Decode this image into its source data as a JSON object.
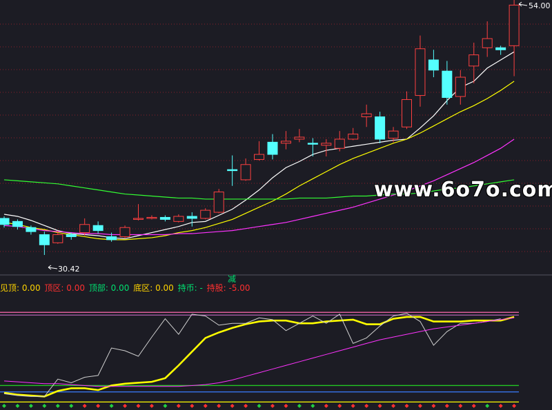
{
  "chart_data": [
    {
      "type": "candlestick",
      "panel": "price",
      "ylim": [
        28.5,
        55.5
      ],
      "grid": true,
      "high_label": "54.00",
      "low_label": "30.42",
      "candles": [
        {
          "o": 34.0,
          "c": 33.4,
          "h": 34.2,
          "l": 33.1
        },
        {
          "o": 33.7,
          "c": 33.2,
          "h": 33.9,
          "l": 32.9
        },
        {
          "o": 33.1,
          "c": 32.7,
          "h": 33.3,
          "l": 32.4
        },
        {
          "o": 32.4,
          "c": 31.4,
          "h": 32.7,
          "l": 30.4
        },
        {
          "o": 31.6,
          "c": 32.4,
          "h": 32.8,
          "l": 31.5
        },
        {
          "o": 32.4,
          "c": 32.2,
          "h": 32.6,
          "l": 31.9
        },
        {
          "o": 32.6,
          "c": 33.4,
          "h": 34.0,
          "l": 32.3
        },
        {
          "o": 33.3,
          "c": 32.8,
          "h": 33.7,
          "l": 32.5
        },
        {
          "o": 32.2,
          "c": 31.9,
          "h": 32.6,
          "l": 31.7
        },
        {
          "o": 32.2,
          "c": 33.1,
          "h": 33.3,
          "l": 32.0
        },
        {
          "o": 33.9,
          "c": 34.0,
          "h": 35.4,
          "l": 33.8
        },
        {
          "o": 34.0,
          "c": 34.1,
          "h": 34.3,
          "l": 33.9
        },
        {
          "o": 34.1,
          "c": 33.9,
          "h": 34.3,
          "l": 33.7
        },
        {
          "o": 33.7,
          "c": 34.2,
          "h": 34.4,
          "l": 33.6
        },
        {
          "o": 34.2,
          "c": 34.0,
          "h": 34.6,
          "l": 33.2
        },
        {
          "o": 34.0,
          "c": 34.8,
          "h": 35.0,
          "l": 33.9
        },
        {
          "o": 34.6,
          "c": 36.6,
          "h": 36.9,
          "l": 34.5
        },
        {
          "o": 38.8,
          "c": 38.7,
          "h": 40.2,
          "l": 37.2
        },
        {
          "o": 37.8,
          "c": 39.3,
          "h": 39.9,
          "l": 37.7
        },
        {
          "o": 39.8,
          "c": 40.3,
          "h": 41.6,
          "l": 39.7
        },
        {
          "o": 41.5,
          "c": 40.3,
          "h": 42.3,
          "l": 39.8
        },
        {
          "o": 41.4,
          "c": 41.6,
          "h": 42.6,
          "l": 40.8
        },
        {
          "o": 41.8,
          "c": 42.0,
          "h": 42.8,
          "l": 41.5
        },
        {
          "o": 41.4,
          "c": 41.3,
          "h": 41.9,
          "l": 40.1
        },
        {
          "o": 41.2,
          "c": 41.4,
          "h": 41.8,
          "l": 40.1
        },
        {
          "o": 40.9,
          "c": 41.8,
          "h": 42.6,
          "l": 40.6
        },
        {
          "o": 41.8,
          "c": 42.3,
          "h": 42.9,
          "l": 41.7
        },
        {
          "o": 44.0,
          "c": 44.3,
          "h": 45.2,
          "l": 43.0
        },
        {
          "o": 44.0,
          "c": 41.8,
          "h": 44.5,
          "l": 41.4
        },
        {
          "o": 41.9,
          "c": 42.6,
          "h": 43.0,
          "l": 41.5
        },
        {
          "o": 43.0,
          "c": 45.7,
          "h": 46.5,
          "l": 42.8
        },
        {
          "o": 46.1,
          "c": 50.7,
          "h": 52.0,
          "l": 45.0
        },
        {
          "o": 49.6,
          "c": 48.6,
          "h": 50.6,
          "l": 47.9
        },
        {
          "o": 48.5,
          "c": 45.9,
          "h": 49.5,
          "l": 45.2
        },
        {
          "o": 46.0,
          "c": 47.9,
          "h": 48.6,
          "l": 45.2
        },
        {
          "o": 49.0,
          "c": 50.1,
          "h": 51.3,
          "l": 47.3
        },
        {
          "o": 50.8,
          "c": 51.7,
          "h": 53.4,
          "l": 49.9
        },
        {
          "o": 50.8,
          "c": 50.6,
          "h": 51.0,
          "l": 50.1
        },
        {
          "o": 51.0,
          "c": 55.0,
          "h": 56.0,
          "l": 48.0
        }
      ],
      "ma_series": [
        {
          "color": "#ffffff",
          "values": [
            34.4,
            34.2,
            33.8,
            33.3,
            32.8,
            32.5,
            32.4,
            32.3,
            32.1,
            32.0,
            32.3,
            32.6,
            32.9,
            33.2,
            33.6,
            33.7,
            34.3,
            34.9,
            35.8,
            36.8,
            38.0,
            39.0,
            39.6,
            40.3,
            40.7,
            40.9,
            41.1,
            41.3,
            41.5,
            41.7,
            41.8,
            42.9,
            44.1,
            45.6,
            46.9,
            47.5,
            48.8,
            49.6,
            50.4
          ]
        },
        {
          "color": "#ffff00",
          "values": [
            33.6,
            33.4,
            33.1,
            32.9,
            32.6,
            32.4,
            32.2,
            32.0,
            31.9,
            31.9,
            32.0,
            32.1,
            32.3,
            32.6,
            32.8,
            33.1,
            33.5,
            33.9,
            34.5,
            35.1,
            35.7,
            36.4,
            37.2,
            37.9,
            38.6,
            39.3,
            39.9,
            40.4,
            40.9,
            41.4,
            41.8,
            42.4,
            43.1,
            43.8,
            44.5,
            45.1,
            45.8,
            46.6,
            47.5
          ]
        },
        {
          "color": "#ff33ff",
          "values": [
            33.3,
            33.2,
            33.0,
            32.8,
            32.7,
            32.6,
            32.5,
            32.5,
            32.4,
            32.4,
            32.4,
            32.4,
            32.4,
            32.5,
            32.5,
            32.6,
            32.7,
            32.8,
            33.0,
            33.2,
            33.4,
            33.6,
            33.9,
            34.2,
            34.5,
            34.8,
            35.1,
            35.5,
            35.9,
            36.3,
            36.7,
            37.2,
            37.7,
            38.3,
            38.9,
            39.5,
            40.2,
            40.9,
            41.8
          ]
        },
        {
          "color": "#33ff33",
          "values": [
            37.8,
            37.7,
            37.6,
            37.5,
            37.4,
            37.2,
            37.0,
            36.8,
            36.6,
            36.4,
            36.3,
            36.2,
            36.1,
            36.0,
            36.0,
            35.9,
            35.9,
            35.9,
            35.9,
            35.9,
            35.9,
            35.9,
            36.0,
            36.0,
            36.0,
            36.1,
            36.2,
            36.2,
            36.3,
            36.4,
            36.4,
            36.5,
            36.7,
            36.9,
            37.0,
            37.2,
            37.4,
            37.6,
            37.8
          ]
        }
      ]
    },
    {
      "type": "line",
      "panel": "indicator",
      "ylim": [
        0,
        110
      ],
      "legend": [
        {
          "label": "见顶: 0.00",
          "color": "#ffd400"
        },
        {
          "label": "顶区: 0.00",
          "color": "#ff3030"
        },
        {
          "label": "顶部: 0.00",
          "color": "#00e070"
        },
        {
          "label": "底区: 0.00",
          "color": "#ffd400"
        },
        {
          "label": "持币: -",
          "color": "#00e070"
        },
        {
          "label": "持股: -5.00",
          "color": "#ff3030"
        }
      ],
      "hlines": [
        {
          "value": 100,
          "color": "#ff6ab0"
        },
        {
          "value": 97,
          "color": "#b060b0"
        },
        {
          "value": 20,
          "color": "#22c822"
        },
        {
          "value": 13,
          "color": "#3a7cff"
        },
        {
          "value": 2,
          "color": "#ffff00"
        }
      ],
      "series": [
        {
          "color": "#ffff00",
          "values": [
            12,
            10,
            9,
            8,
            14,
            17,
            17,
            15,
            20,
            22,
            23,
            24,
            28,
            42,
            57,
            72,
            78,
            83,
            87,
            90,
            91,
            91,
            88,
            88,
            90,
            91,
            92,
            87,
            87,
            93,
            95,
            95,
            90,
            90,
            90,
            91,
            91,
            91,
            95
          ]
        },
        {
          "color": "#cfcfcf",
          "values": [
            11,
            9,
            8,
            8,
            27,
            23,
            29,
            31,
            61,
            58,
            52,
            73,
            93,
            76,
            98,
            96,
            86,
            88,
            88,
            94,
            92,
            80,
            88,
            96,
            88,
            98,
            66,
            72,
            85,
            96,
            99,
            90,
            64,
            79,
            88,
            88,
            90,
            93
          ]
        },
        {
          "color": "#ff33ff",
          "values": [
            25,
            24,
            23,
            22,
            22,
            21,
            20,
            19,
            19,
            19,
            19,
            19,
            19,
            19,
            20,
            21,
            23,
            26,
            30,
            34,
            38,
            42,
            46,
            50,
            54,
            58,
            62,
            66,
            70,
            73,
            76,
            79,
            82,
            84,
            86,
            88,
            90,
            92,
            94
          ]
        }
      ],
      "markers_bottom": [
        "g",
        "g",
        "g",
        "g",
        "g",
        "g",
        "r",
        "r",
        "g",
        "r",
        "r",
        "r",
        "g",
        "r",
        "r",
        "r",
        "r",
        "r",
        "r",
        "g",
        "r",
        "r",
        "g",
        "g",
        "r",
        "r",
        "r",
        "r",
        "r",
        "r",
        "r",
        "r",
        "r",
        "r",
        "r",
        "r",
        "g",
        "r",
        "r"
      ]
    }
  ],
  "annotations": {
    "watermark": "www.6o7o.com",
    "jian_label": "减"
  }
}
